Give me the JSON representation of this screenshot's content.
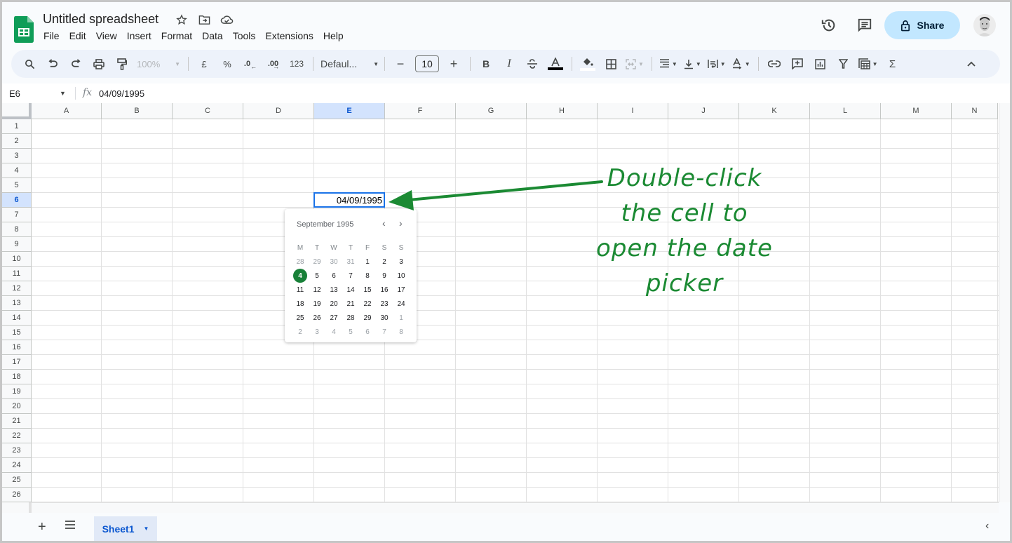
{
  "app": {
    "title": "Untitled spreadsheet",
    "brand_color": "#188038",
    "accent_color": "#1a73e8"
  },
  "title_icons": [
    "star-icon",
    "move-to-folder-icon",
    "cloud-saved-icon"
  ],
  "menu": [
    "File",
    "Edit",
    "View",
    "Insert",
    "Format",
    "Data",
    "Tools",
    "Extensions",
    "Help"
  ],
  "header_right": {
    "share_label": "Share",
    "share_bg": "#c2e7ff"
  },
  "toolbar": {
    "zoom": "100%",
    "currency": "£",
    "percent": "%",
    "decrease_decimal": ".0",
    "increase_decimal": ".00",
    "more_formats": "123",
    "font": "Defaul...",
    "font_size": "10",
    "bold": "B",
    "italic": "I",
    "sum": "Σ"
  },
  "formula_bar": {
    "name_box": "E6",
    "fx": "fx",
    "value": "04/09/1995"
  },
  "grid": {
    "columns": [
      "A",
      "B",
      "C",
      "D",
      "E",
      "F",
      "G",
      "H",
      "I",
      "J",
      "K",
      "L",
      "M",
      "N"
    ],
    "rows": [
      "1",
      "2",
      "3",
      "4",
      "5",
      "6",
      "7",
      "8",
      "9",
      "10",
      "11",
      "12",
      "13",
      "14",
      "15",
      "16",
      "17",
      "18",
      "19",
      "20",
      "21",
      "22",
      "23",
      "24",
      "25",
      "26"
    ],
    "selected_column": "E",
    "selected_row": "6",
    "active_cell": {
      "ref": "E6",
      "value": "04/09/1995"
    }
  },
  "datepicker": {
    "month_label": "September 1995",
    "weekdays": [
      "M",
      "T",
      "W",
      "T",
      "F",
      "S",
      "S"
    ],
    "weeks": [
      [
        {
          "d": "28",
          "o": true
        },
        {
          "d": "29",
          "o": true
        },
        {
          "d": "30",
          "o": true
        },
        {
          "d": "31",
          "o": true
        },
        {
          "d": "1"
        },
        {
          "d": "2"
        },
        {
          "d": "3"
        }
      ],
      [
        {
          "d": "4",
          "s": true
        },
        {
          "d": "5"
        },
        {
          "d": "6"
        },
        {
          "d": "7"
        },
        {
          "d": "8"
        },
        {
          "d": "9"
        },
        {
          "d": "10"
        }
      ],
      [
        {
          "d": "11"
        },
        {
          "d": "12"
        },
        {
          "d": "13"
        },
        {
          "d": "14"
        },
        {
          "d": "15"
        },
        {
          "d": "16"
        },
        {
          "d": "17"
        }
      ],
      [
        {
          "d": "18"
        },
        {
          "d": "19"
        },
        {
          "d": "20"
        },
        {
          "d": "21"
        },
        {
          "d": "22"
        },
        {
          "d": "23"
        },
        {
          "d": "24"
        }
      ],
      [
        {
          "d": "25"
        },
        {
          "d": "26"
        },
        {
          "d": "27"
        },
        {
          "d": "28"
        },
        {
          "d": "29"
        },
        {
          "d": "30"
        },
        {
          "d": "1",
          "o": true
        }
      ],
      [
        {
          "d": "2",
          "o": true
        },
        {
          "d": "3",
          "o": true
        },
        {
          "d": "4",
          "o": true
        },
        {
          "d": "5",
          "o": true
        },
        {
          "d": "6",
          "o": true
        },
        {
          "d": "7",
          "o": true
        },
        {
          "d": "8",
          "o": true
        }
      ]
    ],
    "selected_color": "#188038"
  },
  "annotation": {
    "lines": [
      "Double-click",
      "the cell to",
      "open the date",
      "picker"
    ],
    "color": "#1b8a33"
  },
  "sheets": {
    "tabs": [
      {
        "label": "Sheet1",
        "active": true
      }
    ]
  }
}
